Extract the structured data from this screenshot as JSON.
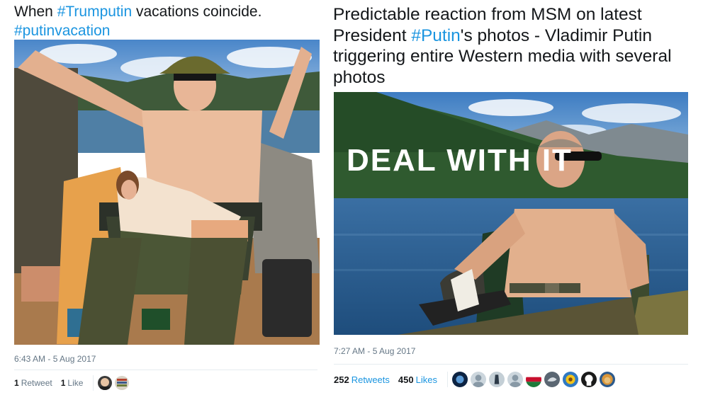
{
  "left_tweet": {
    "text_before": "When ",
    "hashtag_1": "#Trumputin",
    "text_middle": " vacations coincide.",
    "hashtag_2": "#putinvacation",
    "timestamp": "6:43 AM - 5 Aug 2017",
    "retweets_count": "1",
    "retweets_label": "Retweet",
    "likes_count": "1",
    "likes_label": "Like",
    "liker_avatars": [
      "avatar-face",
      "avatar-stack"
    ]
  },
  "right_tweet": {
    "text_before": "Predictable reaction from MSM on latest President ",
    "hashtag_1": "#Putin",
    "text_after": "'s photos - Vladimir Putin triggering entire Western media with several photos",
    "overlay_text": "DEAL WITH IT",
    "timestamp": "7:27 AM - 5 Aug 2017",
    "retweets_count": "252",
    "retweets_label": "Retweets",
    "likes_count": "450",
    "likes_label": "Likes",
    "liker_avatars": [
      "avatar-dark",
      "avatar-default",
      "avatar-figure",
      "avatar-default",
      "avatar-flag",
      "avatar-bird",
      "avatar-sunflower",
      "avatar-dark",
      "avatar-lion"
    ]
  },
  "colors": {
    "hashtag": "#1b95e0",
    "text": "#14171a",
    "muted": "#657786"
  }
}
